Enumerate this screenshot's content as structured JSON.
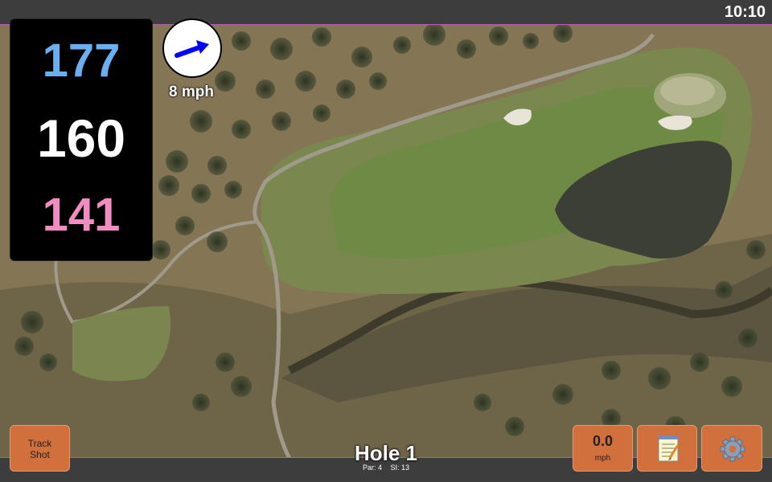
{
  "status_bar": {
    "time": "10:10"
  },
  "distances": {
    "back": "177",
    "center": "160",
    "front": "141",
    "colors": {
      "back": "#6ab0f0",
      "center": "#ffffff",
      "front": "#f08cc0"
    }
  },
  "wind": {
    "speed_label": "8 mph",
    "arrow_color": "#0000ff",
    "icon": "wind-direction-arrow"
  },
  "hole": {
    "title": "Hole 1",
    "par": "Par: 4",
    "stroke_index": "SI: 13"
  },
  "buttons": {
    "track_shot_line1": "Track",
    "track_shot_line2": "Shot",
    "speed_value": "0.0",
    "speed_unit": "mph",
    "notes_icon": "notepad-icon",
    "settings_icon": "gear-icon"
  },
  "theme": {
    "button_color": "#d2703d",
    "border_accent": "#b060b0"
  }
}
